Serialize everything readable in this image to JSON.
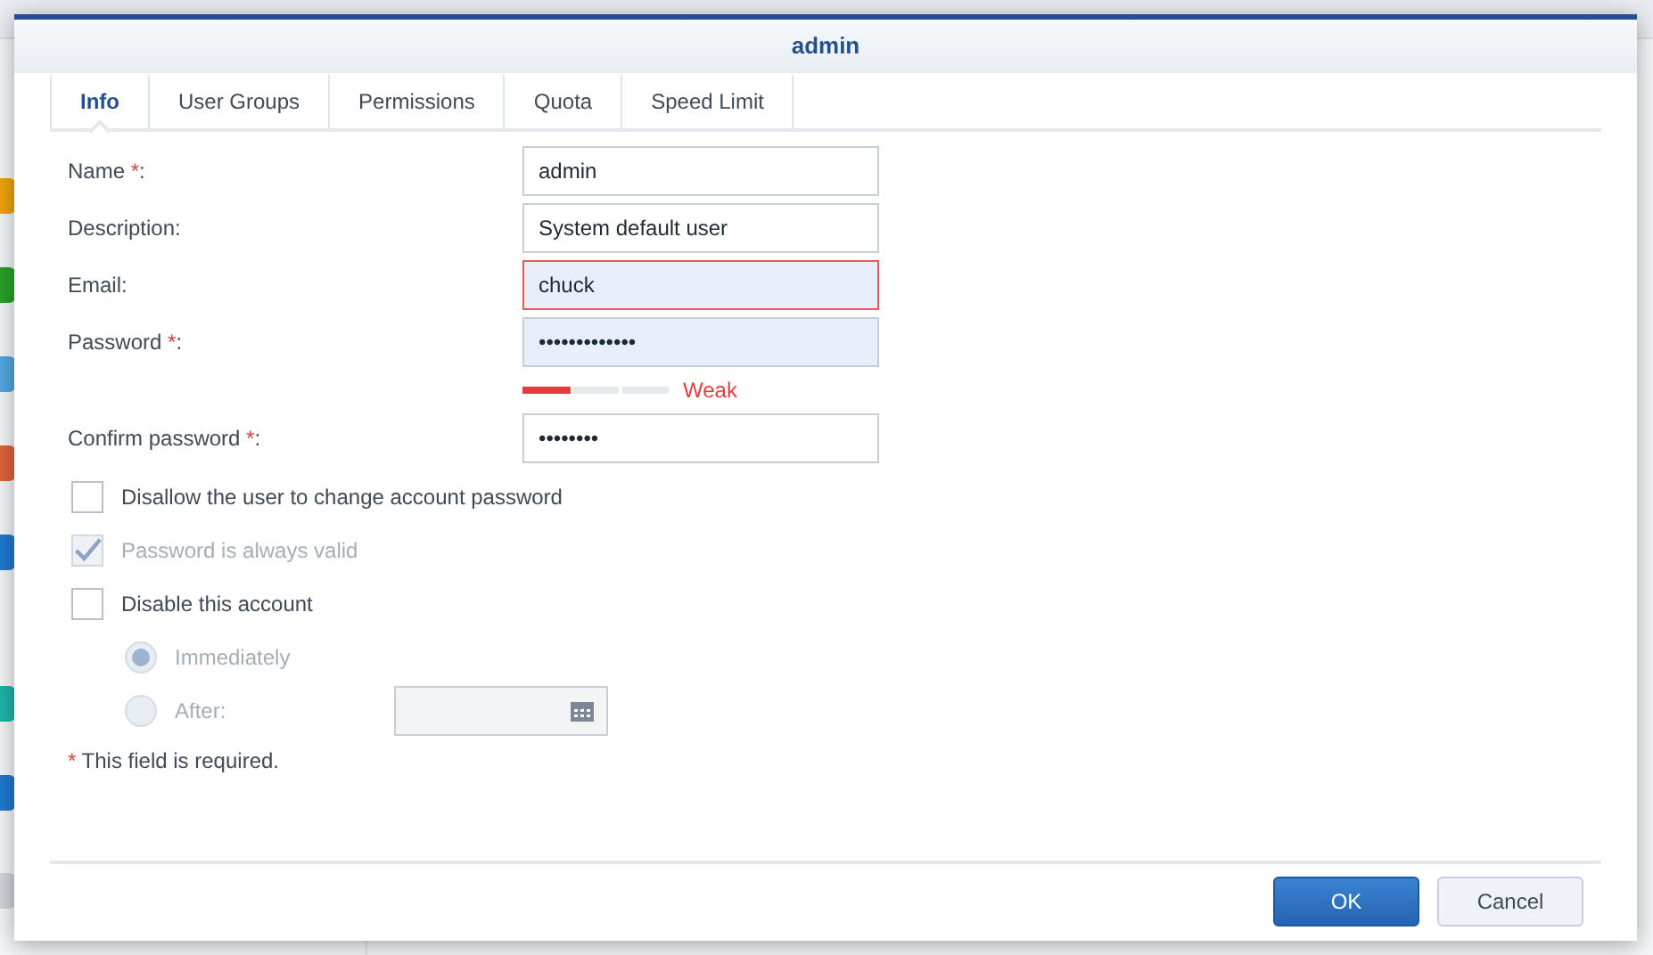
{
  "dialog": {
    "title": "admin",
    "tabs": [
      {
        "label": "Info",
        "selected": true
      },
      {
        "label": "User Groups",
        "selected": false
      },
      {
        "label": "Permissions",
        "selected": false
      },
      {
        "label": "Quota",
        "selected": false
      },
      {
        "label": "Speed Limit",
        "selected": false
      }
    ],
    "fields": [
      {
        "kind": "text",
        "label": "Name ",
        "required_mark": "*",
        "label_end": ":",
        "value": "admin",
        "invalid": false,
        "highlighted": false
      },
      {
        "kind": "text",
        "label": "Description:",
        "value": "System default user",
        "invalid": false,
        "highlighted": false
      },
      {
        "kind": "text",
        "label": "Email:",
        "value": "chuck",
        "invalid": true,
        "highlighted": true
      },
      {
        "kind": "password",
        "label": "Password ",
        "required_mark": "*",
        "label_end": ":",
        "value": "•••••••••••••",
        "invalid": false,
        "highlighted": true
      },
      {
        "kind": "strength",
        "level": 0.33,
        "reading": "Weak"
      },
      {
        "kind": "password",
        "label": "Confirm password ",
        "required_mark": "*",
        "label_end": ":",
        "value": "••••••••",
        "invalid": false,
        "highlighted": false
      }
    ],
    "checkboxes": [
      {
        "label": "Disallow the user to change account password",
        "checked": false,
        "disabled": false
      },
      {
        "label": "Password is always valid",
        "checked": true,
        "disabled": true
      },
      {
        "label": "Disable this account",
        "checked": false,
        "disabled": false
      }
    ],
    "radios": [
      {
        "label": "Immediately",
        "selected": true,
        "disabled": true
      },
      {
        "label": "After:",
        "selected": false,
        "disabled": true,
        "has_date": true
      }
    ],
    "note": {
      "mark": "*",
      "text": "This field is required."
    },
    "buttons": [
      {
        "label": "OK",
        "primary": true
      },
      {
        "label": "Cancel",
        "primary": false
      }
    ]
  }
}
